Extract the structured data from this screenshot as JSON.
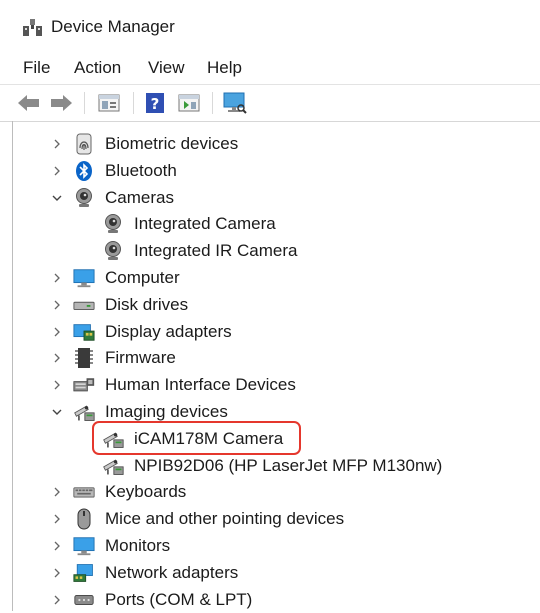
{
  "window": {
    "title": "Device Manager"
  },
  "menu": [
    {
      "label": "File"
    },
    {
      "label": "Action"
    },
    {
      "label": "View"
    },
    {
      "label": "Help"
    }
  ],
  "toolbar": {
    "icons": [
      "back-arrow-icon",
      "forward-arrow-icon",
      "properties-icon",
      "help-icon",
      "update-driver-icon",
      "scan-hardware-icon"
    ]
  },
  "tree": [
    {
      "label": "Biometric devices",
      "level": 0,
      "state": "collapsed",
      "icon": "fingerprint-icon"
    },
    {
      "label": "Bluetooth",
      "level": 0,
      "state": "collapsed",
      "icon": "bluetooth-icon"
    },
    {
      "label": "Cameras",
      "level": 0,
      "state": "expanded",
      "icon": "webcam-icon"
    },
    {
      "label": "Integrated Camera",
      "level": 1,
      "state": "none",
      "icon": "webcam-icon"
    },
    {
      "label": "Integrated IR Camera",
      "level": 1,
      "state": "none",
      "icon": "webcam-icon"
    },
    {
      "label": "Computer",
      "level": 0,
      "state": "collapsed",
      "icon": "monitor-icon"
    },
    {
      "label": "Disk drives",
      "level": 0,
      "state": "collapsed",
      "icon": "disk-drive-icon"
    },
    {
      "label": "Display adapters",
      "level": 0,
      "state": "collapsed",
      "icon": "display-adapter-icon"
    },
    {
      "label": "Firmware",
      "level": 0,
      "state": "collapsed",
      "icon": "chip-icon"
    },
    {
      "label": "Human Interface Devices",
      "level": 0,
      "state": "collapsed",
      "icon": "hid-icon"
    },
    {
      "label": "Imaging devices",
      "level": 0,
      "state": "expanded",
      "icon": "imaging-device-icon"
    },
    {
      "label": "iCAM178M Camera",
      "level": 1,
      "state": "none",
      "icon": "imaging-device-icon",
      "highlighted": true
    },
    {
      "label": "NPIB92D06 (HP LaserJet MFP M130nw)",
      "level": 1,
      "state": "none",
      "icon": "imaging-device-icon"
    },
    {
      "label": "Keyboards",
      "level": 0,
      "state": "collapsed",
      "icon": "keyboard-icon"
    },
    {
      "label": "Mice and other pointing devices",
      "level": 0,
      "state": "collapsed",
      "icon": "mouse-icon"
    },
    {
      "label": "Monitors",
      "level": 0,
      "state": "collapsed",
      "icon": "monitor-icon"
    },
    {
      "label": "Network adapters",
      "level": 0,
      "state": "collapsed",
      "icon": "network-adapter-icon"
    },
    {
      "label": "Ports (COM & LPT)",
      "level": 0,
      "state": "collapsed",
      "icon": "port-icon"
    }
  ],
  "colors": {
    "highlight_border": "#e5372d",
    "accent": "#0a64c8"
  }
}
